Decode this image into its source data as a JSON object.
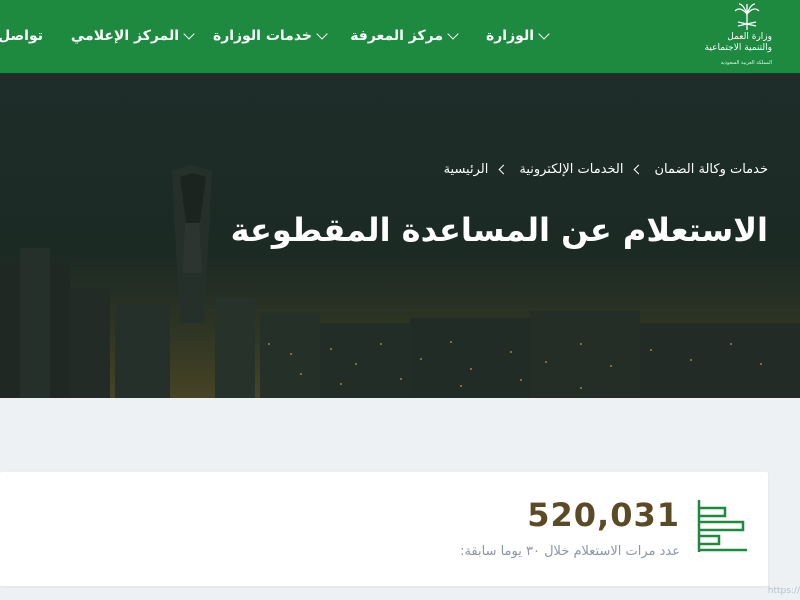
{
  "header": {
    "logo": {
      "line1": "وزارة العمل",
      "line2": "والتنمية الاجتماعية",
      "line3": "المملكة العربية السعودية"
    },
    "nav": [
      {
        "label": "الوزارة",
        "has_dropdown": true
      },
      {
        "label": "مركز المعرفة",
        "has_dropdown": true
      },
      {
        "label": "خدمات الوزارة",
        "has_dropdown": true
      },
      {
        "label": "المركز الإعلامي",
        "has_dropdown": true
      },
      {
        "label": "تواصل",
        "has_dropdown": false
      }
    ]
  },
  "hero": {
    "breadcrumb": [
      "الرئيسية",
      "الخدمات الإلكترونية",
      "خدمات وكالة الضمان"
    ],
    "title": "الاستعلام عن المساعدة المقطوعة"
  },
  "stats": {
    "value": "520,031",
    "label": "عدد مرات الاستعلام خلال ٣٠ يوما سابقة:"
  },
  "footer_fragment": "https://",
  "colors": {
    "header_green": "#1d8a3f",
    "stat_value": "#5b4a26",
    "stat_label": "#8a96a8",
    "icon_green": "#1d8a3f"
  }
}
